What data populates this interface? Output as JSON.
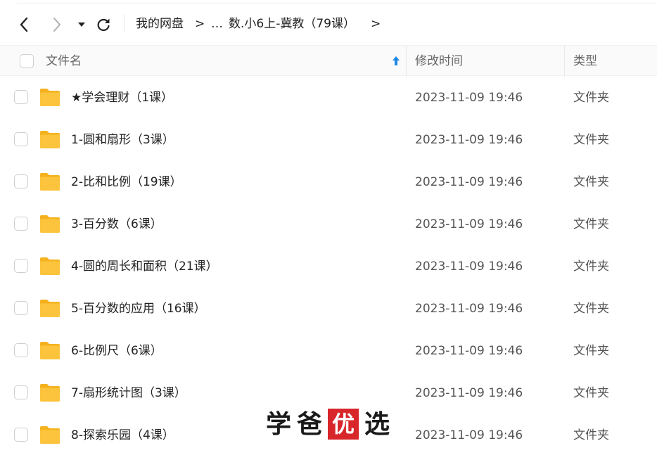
{
  "breadcrumb": {
    "root": "我的网盘",
    "ellipsis": "…",
    "current": "数.小6上-冀教（79课）"
  },
  "columns": {
    "name": "文件名",
    "modified": "修改时间",
    "type": "类型"
  },
  "files": [
    {
      "name": "★学会理财（1课）",
      "modified": "2023-11-09 19:46",
      "type": "文件夹"
    },
    {
      "name": "1-圆和扇形（3课）",
      "modified": "2023-11-09 19:46",
      "type": "文件夹"
    },
    {
      "name": "2-比和比例（19课）",
      "modified": "2023-11-09 19:46",
      "type": "文件夹"
    },
    {
      "name": "3-百分数（6课）",
      "modified": "2023-11-09 19:46",
      "type": "文件夹"
    },
    {
      "name": "4-圆的周长和面积（21课）",
      "modified": "2023-11-09 19:46",
      "type": "文件夹"
    },
    {
      "name": "5-百分数的应用（16课）",
      "modified": "2023-11-09 19:46",
      "type": "文件夹"
    },
    {
      "name": "6-比例尺（6课）",
      "modified": "2023-11-09 19:46",
      "type": "文件夹"
    },
    {
      "name": "7-扇形统计图（3课）",
      "modified": "2023-11-09 19:46",
      "type": "文件夹"
    },
    {
      "name": "8-探索乐园（4课）",
      "modified": "2023-11-09 19:46",
      "type": "文件夹"
    }
  ],
  "watermark": {
    "char1": "学",
    "char2": "爸",
    "seal": "优",
    "char4": "选"
  },
  "icons": {
    "back": "chevron-left-icon",
    "forward": "chevron-right-icon",
    "dropdown": "caret-down-icon",
    "refresh": "refresh-icon",
    "sort": "sort-ascending-icon",
    "folder": "folder-icon"
  },
  "colors": {
    "folder": "#fcc43c",
    "sort_arrow": "#1e88e5",
    "seal": "#d8262b"
  }
}
